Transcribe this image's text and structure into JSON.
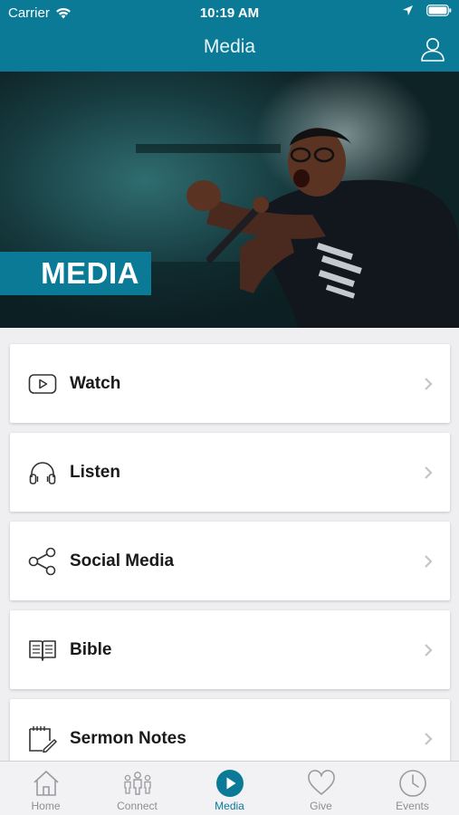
{
  "status_bar": {
    "carrier": "Carrier",
    "time": "10:19 AM"
  },
  "nav": {
    "title": "Media"
  },
  "hero": {
    "badge": "MEDIA"
  },
  "menu": [
    {
      "label": "Watch",
      "icon": "play-video-icon"
    },
    {
      "label": "Listen",
      "icon": "headphones-icon"
    },
    {
      "label": "Social Media",
      "icon": "share-icon"
    },
    {
      "label": "Bible",
      "icon": "book-icon"
    },
    {
      "label": "Sermon Notes",
      "icon": "notepad-icon"
    }
  ],
  "tabs": [
    {
      "label": "Home",
      "icon": "home-icon",
      "active": false
    },
    {
      "label": "Connect",
      "icon": "people-icon",
      "active": false
    },
    {
      "label": "Media",
      "icon": "play-circle-icon",
      "active": true
    },
    {
      "label": "Give",
      "icon": "heart-icon",
      "active": false
    },
    {
      "label": "Events",
      "icon": "clock-icon",
      "active": false
    }
  ],
  "colors": {
    "brand": "#0b7a96",
    "background": "#efeff1",
    "tab_inactive": "#8e8e93"
  }
}
